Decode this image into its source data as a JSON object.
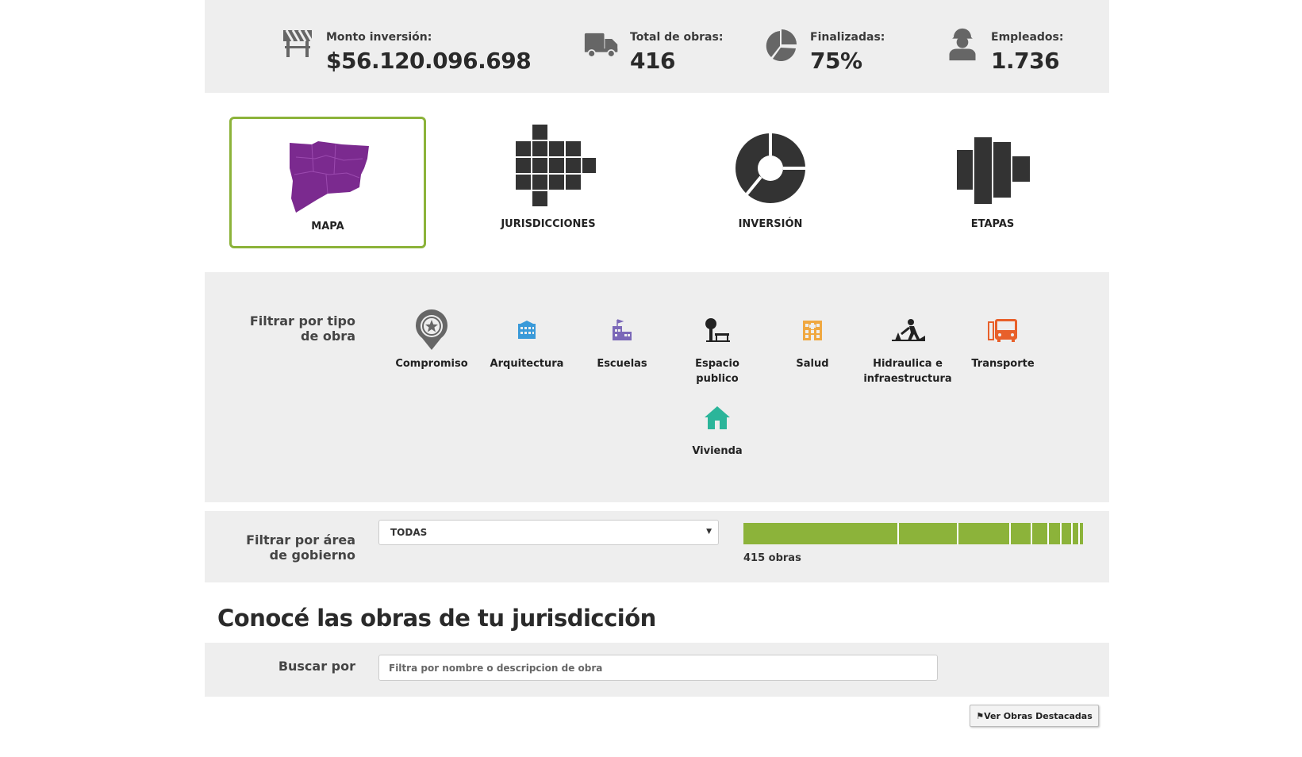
{
  "stats": [
    {
      "label": "Monto inversión:",
      "value": "$56.120.096.698",
      "icon": "road-barrier-icon"
    },
    {
      "label": "Total de obras:",
      "value": "416",
      "icon": "truck-icon"
    },
    {
      "label": "Finalizadas:",
      "value": "75%",
      "icon": "pie-chart-icon"
    },
    {
      "label": "Empleados:",
      "value": "1.736",
      "icon": "worker-icon"
    }
  ],
  "views": [
    {
      "label": "MAPA",
      "active": true
    },
    {
      "label": "JURISDICCIONES",
      "active": false
    },
    {
      "label": "INVERSIÓN",
      "active": false
    },
    {
      "label": "ETAPAS",
      "active": false
    }
  ],
  "type_filter": {
    "title_line1": "Filtrar por tipo",
    "title_line2": "de obra",
    "types": [
      {
        "label_line1": "Compromiso",
        "label_line2": "",
        "color": "#555555"
      },
      {
        "label_line1": "Arquitectura",
        "label_line2": "",
        "color": "#3a9ad9"
      },
      {
        "label_line1": "Escuelas",
        "label_line2": "",
        "color": "#7b68b8"
      },
      {
        "label_line1": "Espacio",
        "label_line2": "publico",
        "color": "#222222"
      },
      {
        "label_line1": "Salud",
        "label_line2": "",
        "color": "#f0a840"
      },
      {
        "label_line1": "Hidraulica e",
        "label_line2": "infraestructura",
        "color": "#222222"
      },
      {
        "label_line1": "Transporte",
        "label_line2": "",
        "color": "#e8602a"
      },
      {
        "label_line1": "Vivienda",
        "label_line2": "",
        "color": "#2bb59a"
      }
    ]
  },
  "area_filter": {
    "title_line1": "Filtrar por área",
    "title_line2": "de gobierno",
    "selected": "TODAS",
    "count_label": "415 obras",
    "bar_color": "#8cb33a"
  },
  "heading": "Conocé las obras de tu jurisdicción",
  "search": {
    "label": "Buscar por",
    "placeholder": "Filtra por nombre o descripcion de obra"
  },
  "destacadas_button": "Ver Obras Destacadas"
}
